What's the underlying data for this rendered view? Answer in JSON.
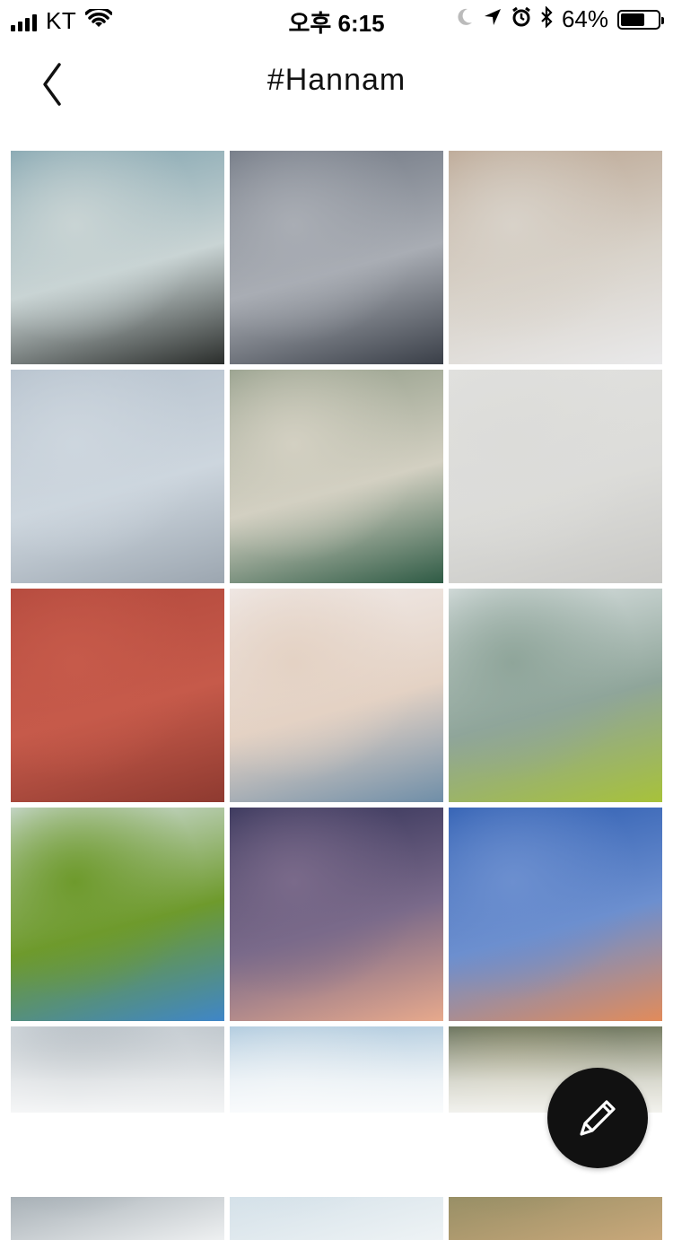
{
  "status_bar": {
    "carrier": "KT",
    "time": "오후 6:15",
    "battery_percent_label": "64%",
    "battery_level": 0.64,
    "icons": [
      "signal-icon",
      "wifi-icon",
      "moon-icon",
      "location-arrow-icon",
      "alarm-icon",
      "bluetooth-icon",
      "battery-icon"
    ]
  },
  "nav": {
    "title": "#Hannam",
    "back_icon": "chevron-left-icon"
  },
  "photos": [
    {
      "desc_icon": "photo",
      "colors": [
        "#7da1ad",
        "#c9d4d4",
        "#2b2e2c"
      ]
    },
    {
      "desc_icon": "photo",
      "colors": [
        "#6d7480",
        "#a9adb4",
        "#3a3f48"
      ]
    },
    {
      "desc_icon": "photo",
      "colors": [
        "#b9a38f",
        "#d8d2c9",
        "#e9e9ea"
      ]
    },
    {
      "desc_icon": "photo",
      "colors": [
        "#b4c0cc",
        "#cdd6de",
        "#9ca6b0"
      ]
    },
    {
      "desc_icon": "photo",
      "colors": [
        "#8f9a86",
        "#d3d0c2",
        "#2f5b45"
      ]
    },
    {
      "desc_icon": "photo",
      "colors": [
        "#e1e1df",
        "#dcdcd9",
        "#c9c9c6"
      ]
    },
    {
      "desc_icon": "photo",
      "colors": [
        "#b2483c",
        "#c65a4a",
        "#8e3a30"
      ]
    },
    {
      "desc_icon": "photo",
      "colors": [
        "#f1eceb",
        "#e4d2c4",
        "#6f8ea8"
      ]
    },
    {
      "desc_icon": "photo",
      "colors": [
        "#dfe5e6",
        "#8fa59a",
        "#a7c23a"
      ]
    },
    {
      "desc_icon": "photo",
      "colors": [
        "#d8e3ea",
        "#6e9a2c",
        "#3f86c8"
      ]
    },
    {
      "desc_icon": "photo",
      "colors": [
        "#2f2f55",
        "#7a6a8a",
        "#e7a98c"
      ]
    },
    {
      "desc_icon": "photo",
      "colors": [
        "#2b5bb0",
        "#6c8fcf",
        "#e28b5a"
      ]
    },
    {
      "desc_icon": "photo",
      "colors": [
        "#d7dde2",
        "#9aa4ab",
        "#eef0f1"
      ]
    },
    {
      "desc_icon": "photo",
      "colors": [
        "#a8c6dd",
        "#cfdde6",
        "#eef3f5"
      ]
    },
    {
      "desc_icon": "photo",
      "colors": [
        "#5d6a58",
        "#8e8a62",
        "#c9a87a"
      ]
    }
  ],
  "fab": {
    "icon": "pencil-icon"
  }
}
